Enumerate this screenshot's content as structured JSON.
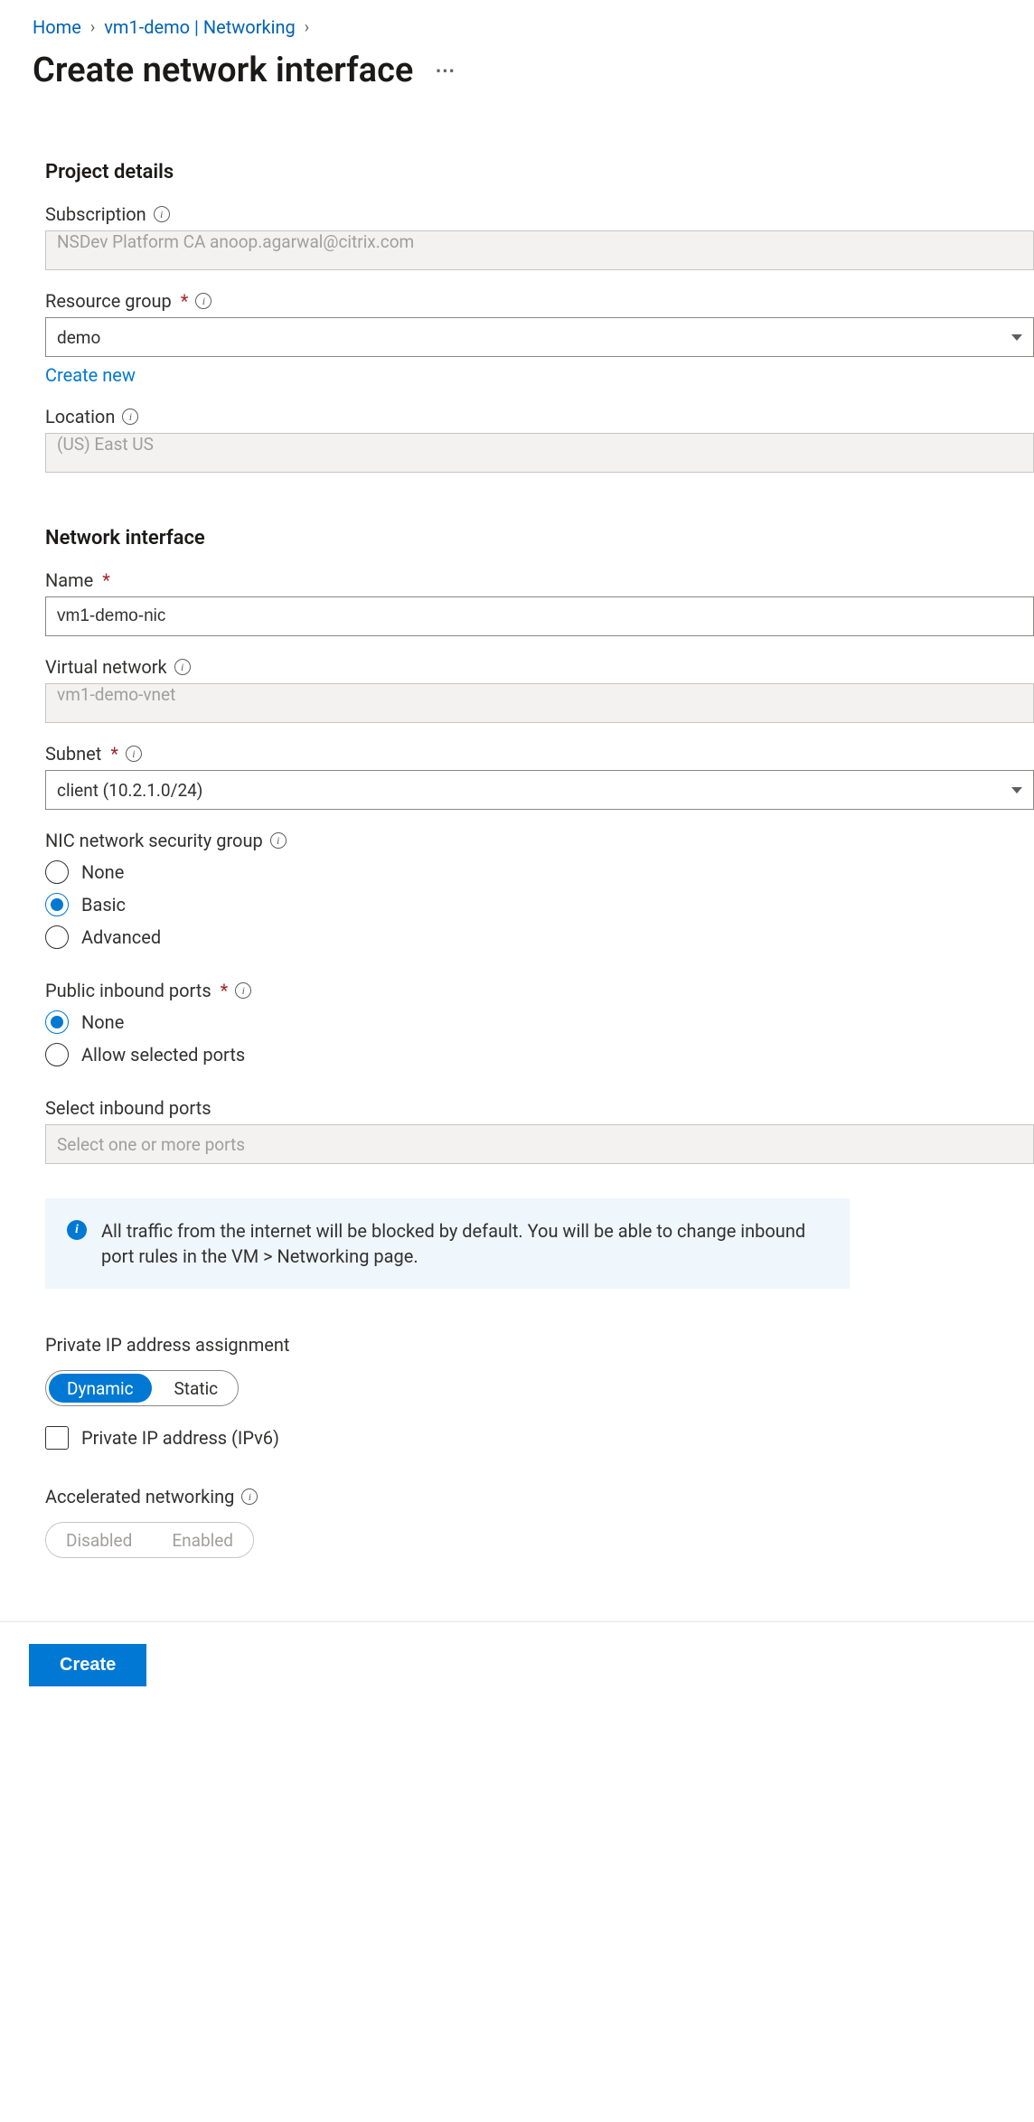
{
  "breadcrumb": {
    "home": "Home",
    "item2": "vm1-demo | Networking"
  },
  "pageTitle": "Create network interface",
  "sections": {
    "project": "Project details",
    "network": "Network interface"
  },
  "labels": {
    "subscription": "Subscription",
    "resourceGroup": "Resource group",
    "createNew": "Create new",
    "location": "Location",
    "name": "Name",
    "virtualNetwork": "Virtual network",
    "subnet": "Subnet",
    "nsg": "NIC network security group",
    "publicInbound": "Public inbound ports",
    "selectInbound": "Select inbound ports",
    "privateIpAssign": "Private IP address assignment",
    "ipv6": "Private IP address (IPv6)",
    "accelNet": "Accelerated networking"
  },
  "values": {
    "subscription": "NSDev Platform CA anoop.agarwal@citrix.com",
    "resourceGroup": "demo",
    "location": "(US) East US",
    "name": "vm1-demo-nic",
    "virtualNetwork": "vm1-demo-vnet",
    "subnet": "client (10.2.1.0/24)",
    "selectInboundPlaceholder": "Select one or more ports"
  },
  "radios": {
    "nsg": {
      "none": "None",
      "basic": "Basic",
      "advanced": "Advanced"
    },
    "publicInbound": {
      "none": "None",
      "allow": "Allow selected ports"
    }
  },
  "pills": {
    "ipAssign": {
      "dynamic": "Dynamic",
      "static": "Static"
    },
    "accelNet": {
      "disabled": "Disabled",
      "enabled": "Enabled"
    }
  },
  "infoBox": "All traffic from the internet will be blocked by default. You will be able to change inbound port rules in the VM > Networking page.",
  "footer": {
    "create": "Create"
  }
}
